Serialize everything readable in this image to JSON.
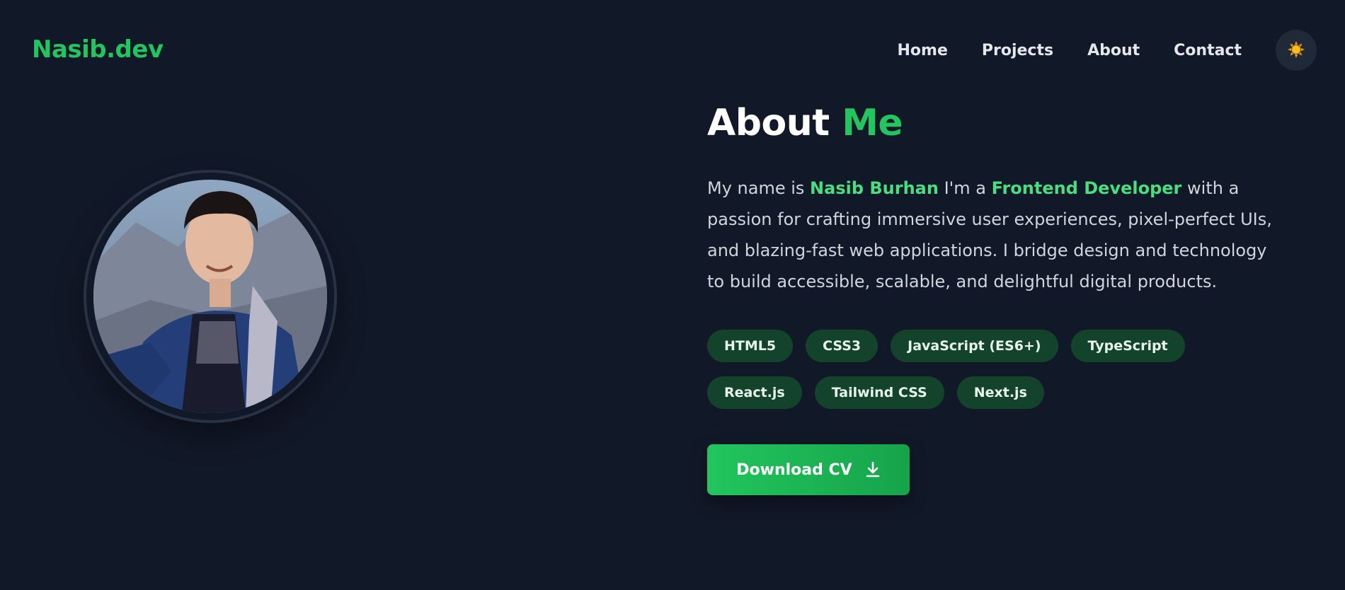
{
  "header": {
    "logo": "Nasib.dev",
    "nav": [
      "Home",
      "Projects",
      "About",
      "Contact"
    ],
    "theme_toggle_icon": "sun-icon"
  },
  "about": {
    "title": "About",
    "title_accent": "Me",
    "bio": {
      "prefix": "My name is ",
      "name": "Nasib Burhan",
      "middle": " I'm a ",
      "role": "Frontend Developer",
      "suffix": " with a passion for crafting immersive user experiences, pixel-perfect UIs, and blazing-fast web applications. I bridge design and technology to build accessible, scalable, and delightful digital products."
    },
    "skills": [
      "HTML5",
      "CSS3",
      "JavaScript (ES6+)",
      "TypeScript",
      "React.js",
      "Tailwind CSS",
      "Next.js"
    ],
    "cv_button": "Download CV",
    "cv_icon": "download-icon"
  },
  "colors": {
    "background": "#111827",
    "accent": "#22c55e",
    "tag_bg": "#14432b"
  }
}
